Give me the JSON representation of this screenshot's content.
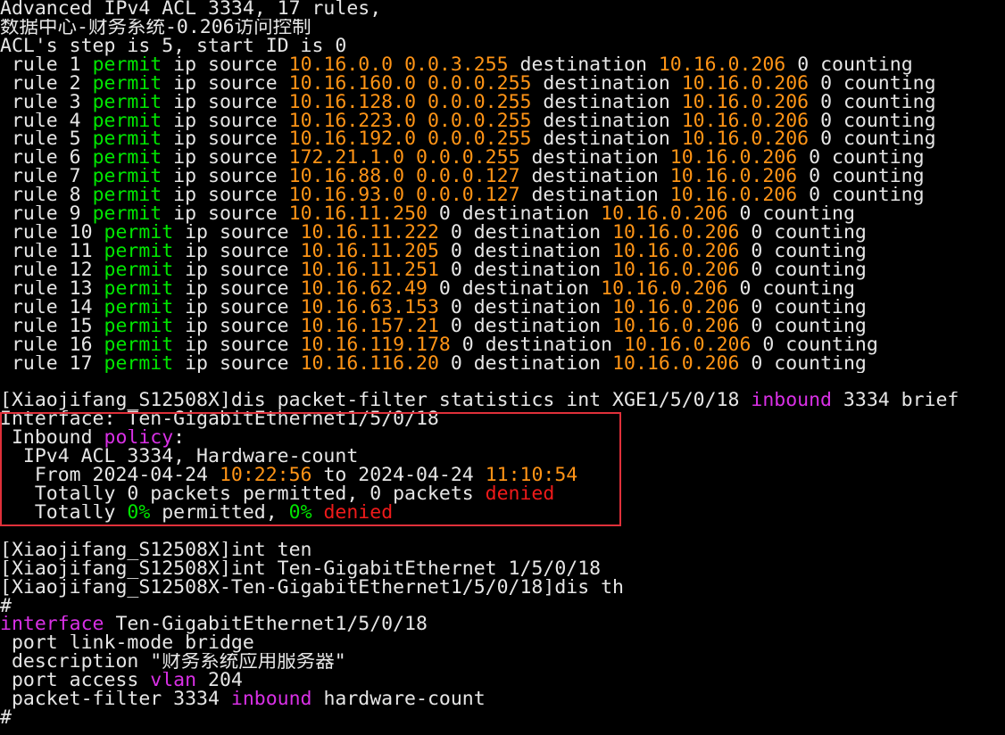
{
  "colors": {
    "background": "#000000",
    "default": "#e6e6e6",
    "green": "#00e600",
    "orange": "#ff9416",
    "magenta": "#d930e6",
    "red": "#ef1a1a",
    "highlight_border": "#e0303a"
  },
  "lines": [
    [
      {
        "t": "Advanced IPv4 ACL 3334, 17 rules,",
        "c": "default"
      }
    ],
    [
      {
        "t": "数据中心-财务系统-0.206访问控制",
        "c": "default"
      }
    ],
    [
      {
        "t": "ACL's step is 5, start ID is 0",
        "c": "default"
      }
    ],
    [
      {
        "t": " rule 1 ",
        "c": "default"
      },
      {
        "t": "permit",
        "c": "green"
      },
      {
        "t": " ip source ",
        "c": "default"
      },
      {
        "t": "10.16.0.0 0.0.3.255",
        "c": "orange"
      },
      {
        "t": " destination ",
        "c": "default"
      },
      {
        "t": "10.16.0.206",
        "c": "orange"
      },
      {
        "t": " 0 counting",
        "c": "default"
      }
    ],
    [
      {
        "t": " rule 2 ",
        "c": "default"
      },
      {
        "t": "permit",
        "c": "green"
      },
      {
        "t": " ip source ",
        "c": "default"
      },
      {
        "t": "10.16.160.0 0.0.0.255",
        "c": "orange"
      },
      {
        "t": " destination ",
        "c": "default"
      },
      {
        "t": "10.16.0.206",
        "c": "orange"
      },
      {
        "t": " 0 counting",
        "c": "default"
      }
    ],
    [
      {
        "t": " rule 3 ",
        "c": "default"
      },
      {
        "t": "permit",
        "c": "green"
      },
      {
        "t": " ip source ",
        "c": "default"
      },
      {
        "t": "10.16.128.0 0.0.0.255",
        "c": "orange"
      },
      {
        "t": " destination ",
        "c": "default"
      },
      {
        "t": "10.16.0.206",
        "c": "orange"
      },
      {
        "t": " 0 counting",
        "c": "default"
      }
    ],
    [
      {
        "t": " rule 4 ",
        "c": "default"
      },
      {
        "t": "permit",
        "c": "green"
      },
      {
        "t": " ip source ",
        "c": "default"
      },
      {
        "t": "10.16.223.0 0.0.0.255",
        "c": "orange"
      },
      {
        "t": " destination ",
        "c": "default"
      },
      {
        "t": "10.16.0.206",
        "c": "orange"
      },
      {
        "t": " 0 counting",
        "c": "default"
      }
    ],
    [
      {
        "t": " rule 5 ",
        "c": "default"
      },
      {
        "t": "permit",
        "c": "green"
      },
      {
        "t": " ip source ",
        "c": "default"
      },
      {
        "t": "10.16.192.0 0.0.0.255",
        "c": "orange"
      },
      {
        "t": " destination ",
        "c": "default"
      },
      {
        "t": "10.16.0.206",
        "c": "orange"
      },
      {
        "t": " 0 counting",
        "c": "default"
      }
    ],
    [
      {
        "t": " rule 6 ",
        "c": "default"
      },
      {
        "t": "permit",
        "c": "green"
      },
      {
        "t": " ip source ",
        "c": "default"
      },
      {
        "t": "172.21.1.0 0.0.0.255",
        "c": "orange"
      },
      {
        "t": " destination ",
        "c": "default"
      },
      {
        "t": "10.16.0.206",
        "c": "orange"
      },
      {
        "t": " 0 counting",
        "c": "default"
      }
    ],
    [
      {
        "t": " rule 7 ",
        "c": "default"
      },
      {
        "t": "permit",
        "c": "green"
      },
      {
        "t": " ip source ",
        "c": "default"
      },
      {
        "t": "10.16.88.0 0.0.0.127",
        "c": "orange"
      },
      {
        "t": " destination ",
        "c": "default"
      },
      {
        "t": "10.16.0.206",
        "c": "orange"
      },
      {
        "t": " 0 counting",
        "c": "default"
      }
    ],
    [
      {
        "t": " rule 8 ",
        "c": "default"
      },
      {
        "t": "permit",
        "c": "green"
      },
      {
        "t": " ip source ",
        "c": "default"
      },
      {
        "t": "10.16.93.0 0.0.0.127",
        "c": "orange"
      },
      {
        "t": " destination ",
        "c": "default"
      },
      {
        "t": "10.16.0.206",
        "c": "orange"
      },
      {
        "t": " 0 counting",
        "c": "default"
      }
    ],
    [
      {
        "t": " rule 9 ",
        "c": "default"
      },
      {
        "t": "permit",
        "c": "green"
      },
      {
        "t": " ip source ",
        "c": "default"
      },
      {
        "t": "10.16.11.250",
        "c": "orange"
      },
      {
        "t": " 0 destination ",
        "c": "default"
      },
      {
        "t": "10.16.0.206",
        "c": "orange"
      },
      {
        "t": " 0 counting",
        "c": "default"
      }
    ],
    [
      {
        "t": " rule 10 ",
        "c": "default"
      },
      {
        "t": "permit",
        "c": "green"
      },
      {
        "t": " ip source ",
        "c": "default"
      },
      {
        "t": "10.16.11.222",
        "c": "orange"
      },
      {
        "t": " 0 destination ",
        "c": "default"
      },
      {
        "t": "10.16.0.206",
        "c": "orange"
      },
      {
        "t": " 0 counting",
        "c": "default"
      }
    ],
    [
      {
        "t": " rule 11 ",
        "c": "default"
      },
      {
        "t": "permit",
        "c": "green"
      },
      {
        "t": " ip source ",
        "c": "default"
      },
      {
        "t": "10.16.11.205",
        "c": "orange"
      },
      {
        "t": " 0 destination ",
        "c": "default"
      },
      {
        "t": "10.16.0.206",
        "c": "orange"
      },
      {
        "t": " 0 counting",
        "c": "default"
      }
    ],
    [
      {
        "t": " rule 12 ",
        "c": "default"
      },
      {
        "t": "permit",
        "c": "green"
      },
      {
        "t": " ip source ",
        "c": "default"
      },
      {
        "t": "10.16.11.251",
        "c": "orange"
      },
      {
        "t": " 0 destination ",
        "c": "default"
      },
      {
        "t": "10.16.0.206",
        "c": "orange"
      },
      {
        "t": " 0 counting",
        "c": "default"
      }
    ],
    [
      {
        "t": " rule 13 ",
        "c": "default"
      },
      {
        "t": "permit",
        "c": "green"
      },
      {
        "t": " ip source ",
        "c": "default"
      },
      {
        "t": "10.16.62.49",
        "c": "orange"
      },
      {
        "t": " 0 destination ",
        "c": "default"
      },
      {
        "t": "10.16.0.206",
        "c": "orange"
      },
      {
        "t": " 0 counting",
        "c": "default"
      }
    ],
    [
      {
        "t": " rule 14 ",
        "c": "default"
      },
      {
        "t": "permit",
        "c": "green"
      },
      {
        "t": " ip source ",
        "c": "default"
      },
      {
        "t": "10.16.63.153",
        "c": "orange"
      },
      {
        "t": " 0 destination ",
        "c": "default"
      },
      {
        "t": "10.16.0.206",
        "c": "orange"
      },
      {
        "t": " 0 counting",
        "c": "default"
      }
    ],
    [
      {
        "t": " rule 15 ",
        "c": "default"
      },
      {
        "t": "permit",
        "c": "green"
      },
      {
        "t": " ip source ",
        "c": "default"
      },
      {
        "t": "10.16.157.21",
        "c": "orange"
      },
      {
        "t": " 0 destination ",
        "c": "default"
      },
      {
        "t": "10.16.0.206",
        "c": "orange"
      },
      {
        "t": " 0 counting",
        "c": "default"
      }
    ],
    [
      {
        "t": " rule 16 ",
        "c": "default"
      },
      {
        "t": "permit",
        "c": "green"
      },
      {
        "t": " ip source ",
        "c": "default"
      },
      {
        "t": "10.16.119.178",
        "c": "orange"
      },
      {
        "t": " 0 destination ",
        "c": "default"
      },
      {
        "t": "10.16.0.206",
        "c": "orange"
      },
      {
        "t": " 0 counting",
        "c": "default"
      }
    ],
    [
      {
        "t": " rule 17 ",
        "c": "default"
      },
      {
        "t": "permit",
        "c": "green"
      },
      {
        "t": " ip source ",
        "c": "default"
      },
      {
        "t": "10.16.116.20",
        "c": "orange"
      },
      {
        "t": " 0 destination ",
        "c": "default"
      },
      {
        "t": "10.16.0.206",
        "c": "orange"
      },
      {
        "t": " 0 counting",
        "c": "default"
      }
    ],
    [],
    [
      {
        "t": "[Xiaojifang_S12508X]dis packet-filter statistics int XGE1/5/0/18 ",
        "c": "default"
      },
      {
        "t": "inbound",
        "c": "magenta"
      },
      {
        "t": " 3334 brief",
        "c": "default"
      }
    ],
    [
      {
        "t": "Interface: Ten-GigabitEthernet1/5/0/18",
        "c": "default"
      }
    ],
    [
      {
        "t": " Inbound ",
        "c": "default"
      },
      {
        "t": "policy",
        "c": "magenta"
      },
      {
        "t": ":",
        "c": "default"
      }
    ],
    [
      {
        "t": "  IPv4 ACL 3334, Hardware-count",
        "c": "default"
      }
    ],
    [
      {
        "t": "   From 2024-04-24 ",
        "c": "default"
      },
      {
        "t": "10:22:56",
        "c": "orange"
      },
      {
        "t": " to 2024-04-24 ",
        "c": "default"
      },
      {
        "t": "11:10:54",
        "c": "orange"
      }
    ],
    [
      {
        "t": "   Totally 0 packets permitted, 0 packets ",
        "c": "default"
      },
      {
        "t": "denied",
        "c": "red"
      }
    ],
    [
      {
        "t": "   Totally ",
        "c": "default"
      },
      {
        "t": "0%",
        "c": "green"
      },
      {
        "t": " permitted, ",
        "c": "default"
      },
      {
        "t": "0%",
        "c": "green"
      },
      {
        "t": " ",
        "c": "default"
      },
      {
        "t": "denied",
        "c": "red"
      }
    ],
    [],
    [
      {
        "t": "[Xiaojifang_S12508X]int ten",
        "c": "default"
      }
    ],
    [
      {
        "t": "[Xiaojifang_S12508X]int Ten-GigabitEthernet 1/5/0/18",
        "c": "default"
      }
    ],
    [
      {
        "t": "[Xiaojifang_S12508X-Ten-GigabitEthernet1/5/0/18]dis th",
        "c": "default"
      }
    ],
    [
      {
        "t": "#",
        "c": "default"
      }
    ],
    [
      {
        "t": "interface",
        "c": "magenta"
      },
      {
        "t": " Ten-GigabitEthernet1/5/0/18",
        "c": "default"
      }
    ],
    [
      {
        "t": " port link-mode bridge",
        "c": "default"
      }
    ],
    [
      {
        "t": " description \"财务系统应用服务器\"",
        "c": "default"
      }
    ],
    [
      {
        "t": " port access ",
        "c": "default"
      },
      {
        "t": "vlan",
        "c": "magenta"
      },
      {
        "t": " 204",
        "c": "default"
      }
    ],
    [
      {
        "t": " packet-filter 3334 ",
        "c": "default"
      },
      {
        "t": "inbound",
        "c": "magenta"
      },
      {
        "t": " hardware-count",
        "c": "default"
      }
    ],
    [
      {
        "t": "#",
        "c": "default"
      }
    ]
  ]
}
